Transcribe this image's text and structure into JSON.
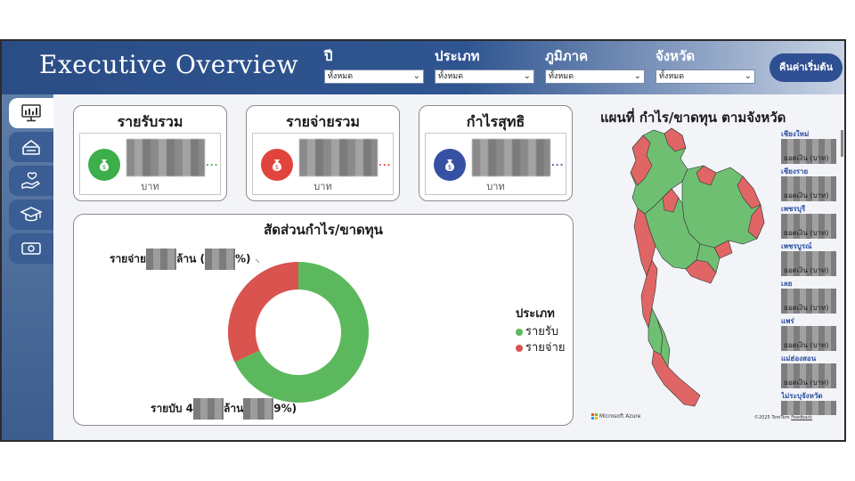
{
  "header": {
    "title": "Executive Overview",
    "filters": [
      {
        "label": "ปี",
        "value": "ทั้งหมด"
      },
      {
        "label": "ประเภท",
        "value": "ทั้งหมด"
      },
      {
        "label": "ภูมิภาค",
        "value": "ทั้งหมด"
      },
      {
        "label": "จังหวัด",
        "value": "ทั้งหมด"
      }
    ],
    "reset_label": "คืนค่าเริ่มต้น"
  },
  "sidebar": {
    "items": [
      {
        "icon": "dashboard-monitor-icon",
        "active": true
      },
      {
        "icon": "inbox-tray-icon",
        "active": false
      },
      {
        "icon": "hand-heart-icon",
        "active": false
      },
      {
        "icon": "graduation-cap-icon",
        "active": false
      },
      {
        "icon": "money-bill-icon",
        "active": false
      }
    ]
  },
  "kpis": [
    {
      "title": "รายรับรวม",
      "unit": "บาท",
      "color": "#3cae4a",
      "icon": "money-bag-icon",
      "dots": "..."
    },
    {
      "title": "รายจ่ายรวม",
      "unit": "บาท",
      "color": "#e0443c",
      "icon": "money-bag-icon",
      "dots": "..."
    },
    {
      "title": "กำไรสุทธิ",
      "unit": "บาท",
      "color": "#3651a3",
      "icon": "money-bag-icon",
      "dots": "..."
    }
  ],
  "donut": {
    "title": "สัดส่วนกำไร/ขาดทุน",
    "label_expense": {
      "prefix": "รายจ่าย",
      "mid": "ล้าน (",
      "suffix": "%)"
    },
    "label_income": {
      "prefix": "รายบับ 4",
      "mid": "ล้าน",
      "suffix": "9%)"
    },
    "legend_title": "ประเภท",
    "legend": [
      {
        "label": "รายรับ",
        "color": "#5cb85c"
      },
      {
        "label": "รายจ่าย",
        "color": "#d9534f"
      }
    ]
  },
  "chart_data": {
    "type": "pie",
    "categories": [
      "รายรับ",
      "รายจ่าย"
    ],
    "values": [
      68,
      32
    ],
    "title": "สัดส่วนกำไร/ขาดทุน",
    "colors": [
      "#5cb85c",
      "#d9534f"
    ]
  },
  "map": {
    "title": "แผนที่ กำไร/ขาดทุน ตามจังหวัด",
    "provinces": [
      {
        "name": "เชียงใหม่",
        "amount_label": "ยอดเงิน (บาท)"
      },
      {
        "name": "เชียงราย",
        "amount_label": "ยอดเงิน (บาท)"
      },
      {
        "name": "เพชรบุรี",
        "amount_label": "ยอดเงิน (บาท)"
      },
      {
        "name": "เพชรบูรณ์",
        "amount_label": "ยอดเงิน (บาท)"
      },
      {
        "name": "เลย",
        "amount_label": "ยอดเงิน (บาท)"
      },
      {
        "name": "แพร่",
        "amount_label": "ยอดเงิน (บาท)"
      },
      {
        "name": "แม่ฮ่องสอน",
        "amount_label": "ยอดเงิน (บาท)"
      },
      {
        "name": "ไม่ระบุจังหวัด",
        "amount_label": ""
      }
    ],
    "attribution_left": "Microsoft Azure",
    "attribution_right": "©2025 TomTom",
    "feedback": "Feedback"
  }
}
